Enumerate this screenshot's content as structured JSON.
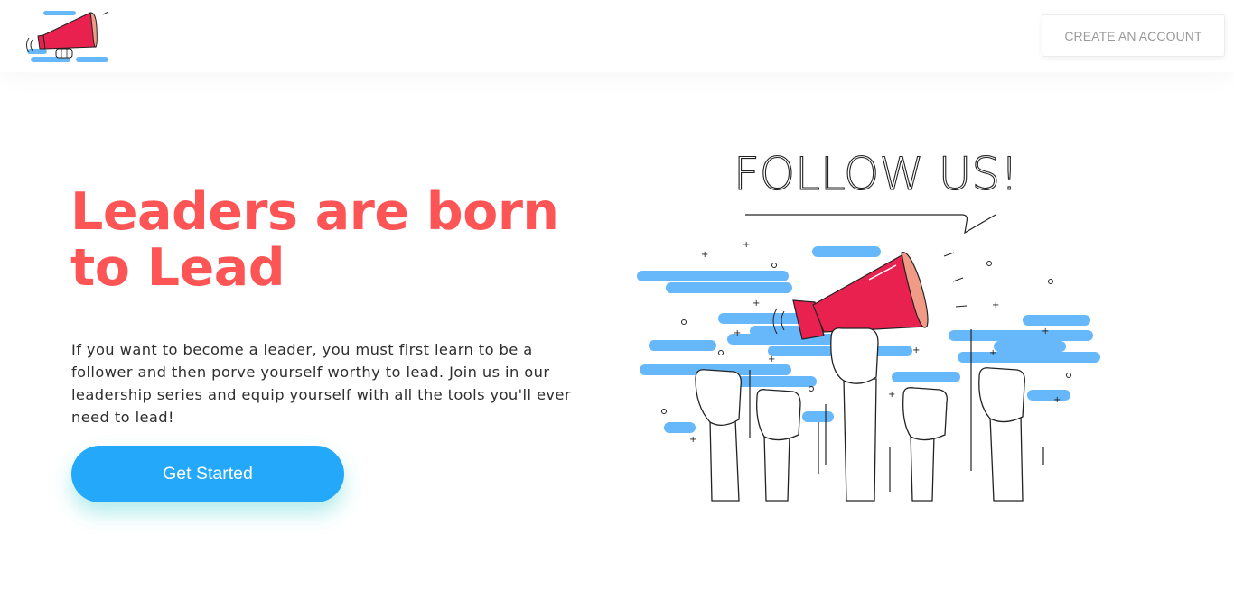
{
  "navbar": {
    "create_account_label": "CREATE AN ACCOUNT"
  },
  "hero": {
    "title": "Leaders are born to Lead",
    "description": "If you want to become a leader, you must first learn to be a follower and then porve yourself worthy to lead. Join us in our leadership series and equip yourself with all the tools you'll ever need to lead!",
    "cta_label": "Get Started"
  },
  "illustration": {
    "banner_text": "FOLLOW US!"
  },
  "colors": {
    "accent_red": "#fd5555",
    "primary_blue": "#24a8f9",
    "megaphone_red": "#e8214f",
    "cloud_blue": "#67b8fb"
  },
  "icons": {
    "logo": "megaphone-logo-icon",
    "illustration": "megaphone-icon"
  }
}
